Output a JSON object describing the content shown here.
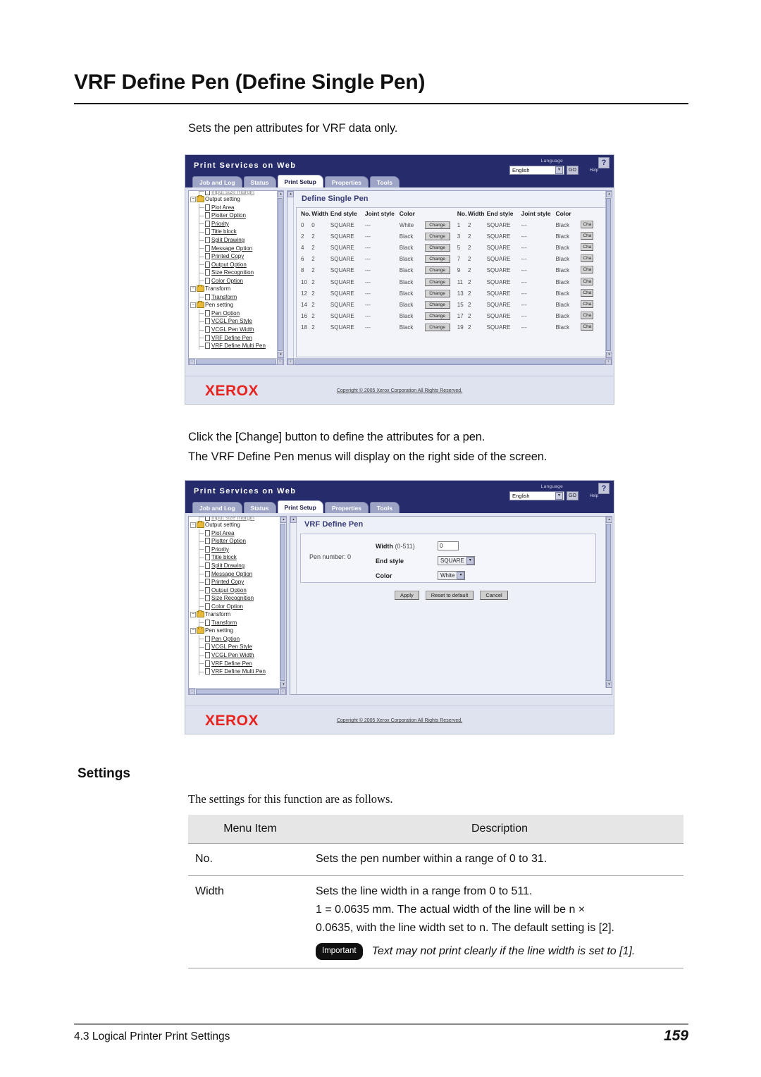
{
  "page": {
    "title": "VRF Define Pen (Define Single Pen)",
    "intro": "Sets the pen attributes for VRF data only.",
    "mid_line_1": "Click the [Change] button to define the attributes for a pen.",
    "mid_line_2": "The VRF Define Pen menus will display on the right side of the screen.",
    "footer_left": "4.3  Logical Printer Print Settings",
    "footer_page": "159"
  },
  "webui": {
    "brand": "Print Services on Web",
    "language_label": "Language",
    "language_value": "English",
    "go_label": "GO",
    "help_label": "Help",
    "help_icon": "?",
    "tabs": [
      {
        "label": "Job and Log",
        "active": false
      },
      {
        "label": "Status",
        "active": false
      },
      {
        "label": "Print Setup",
        "active": true
      },
      {
        "label": "Properties",
        "active": false
      },
      {
        "label": "Tools",
        "active": false
      }
    ],
    "copyright": "Copyright © 2005 Xerox Corporation All Rights Reserved.",
    "logo": "XEROX"
  },
  "tree": {
    "cut_item": "Input size margin",
    "groups": [
      {
        "label": "Output setting",
        "children": [
          "Plot Area",
          "Plotter Option",
          "Priority",
          "Title block",
          "Split Drawing",
          "Message Option",
          "Printed Copy",
          "Output Option",
          "Size Recognition",
          "Color Option"
        ]
      },
      {
        "label": "Transform",
        "children": [
          "Transform"
        ]
      },
      {
        "label": "Pen setting",
        "children": [
          "Pen Option",
          "VCGL Pen Style",
          "VCGL Pen Width",
          "VRF Define Pen",
          "VRF Define Multi Pen"
        ]
      }
    ]
  },
  "screen1": {
    "panel_title": "Define Single Pen",
    "headers": [
      "No.",
      "Width",
      "End style",
      "Joint style",
      "Color"
    ],
    "change_label": "Change",
    "change_label_clipped": "Cha",
    "rows_left": [
      {
        "no": "0",
        "width": "0",
        "end": "SQUARE",
        "joint": "---",
        "color": "White"
      },
      {
        "no": "2",
        "width": "2",
        "end": "SQUARE",
        "joint": "---",
        "color": "Black"
      },
      {
        "no": "4",
        "width": "2",
        "end": "SQUARE",
        "joint": "---",
        "color": "Black"
      },
      {
        "no": "6",
        "width": "2",
        "end": "SQUARE",
        "joint": "---",
        "color": "Black"
      },
      {
        "no": "8",
        "width": "2",
        "end": "SQUARE",
        "joint": "---",
        "color": "Black"
      },
      {
        "no": "10",
        "width": "2",
        "end": "SQUARE",
        "joint": "---",
        "color": "Black"
      },
      {
        "no": "12",
        "width": "2",
        "end": "SQUARE",
        "joint": "---",
        "color": "Black"
      },
      {
        "no": "14",
        "width": "2",
        "end": "SQUARE",
        "joint": "---",
        "color": "Black"
      },
      {
        "no": "16",
        "width": "2",
        "end": "SQUARE",
        "joint": "---",
        "color": "Black"
      },
      {
        "no": "18",
        "width": "2",
        "end": "SQUARE",
        "joint": "---",
        "color": "Black"
      }
    ],
    "rows_right": [
      {
        "no": "1",
        "width": "2",
        "end": "SQUARE",
        "joint": "---",
        "color": "Black"
      },
      {
        "no": "3",
        "width": "2",
        "end": "SQUARE",
        "joint": "---",
        "color": "Black"
      },
      {
        "no": "5",
        "width": "2",
        "end": "SQUARE",
        "joint": "---",
        "color": "Black"
      },
      {
        "no": "7",
        "width": "2",
        "end": "SQUARE",
        "joint": "---",
        "color": "Black"
      },
      {
        "no": "9",
        "width": "2",
        "end": "SQUARE",
        "joint": "---",
        "color": "Black"
      },
      {
        "no": "11",
        "width": "2",
        "end": "SQUARE",
        "joint": "---",
        "color": "Black"
      },
      {
        "no": "13",
        "width": "2",
        "end": "SQUARE",
        "joint": "---",
        "color": "Black"
      },
      {
        "no": "15",
        "width": "2",
        "end": "SQUARE",
        "joint": "---",
        "color": "Black"
      },
      {
        "no": "17",
        "width": "2",
        "end": "SQUARE",
        "joint": "---",
        "color": "Black"
      },
      {
        "no": "19",
        "width": "2",
        "end": "SQUARE",
        "joint": "---",
        "color": "Black"
      }
    ]
  },
  "screen2": {
    "panel_title": "VRF Define Pen",
    "pen_number_label": "Pen number:",
    "pen_number_value": "0",
    "width_label": "Width",
    "width_range": "(0-511)",
    "width_value": "0",
    "endstyle_label": "End style",
    "endstyle_value": "SQUARE",
    "color_label": "Color",
    "color_value": "White",
    "buttons": [
      "Apply",
      "Reset to default",
      "Cancel"
    ]
  },
  "settings": {
    "heading": "Settings",
    "lead": "The settings for this function are as follows.",
    "columns": [
      "Menu Item",
      "Description"
    ],
    "rows": [
      {
        "menu": "No.",
        "desc_lines": [
          "Sets the pen number within a range of 0 to 31."
        ],
        "important": null
      },
      {
        "menu": "Width",
        "desc_lines": [
          "Sets the line width in a range from 0 to 511.",
          "1 = 0.0635 mm. The actual width of the line will be n ×",
          "0.0635, with the line width set to n. The default setting is [2]."
        ],
        "important_badge": "Important",
        "important": "Text may not print clearly if the line width is set to [1]."
      }
    ]
  }
}
